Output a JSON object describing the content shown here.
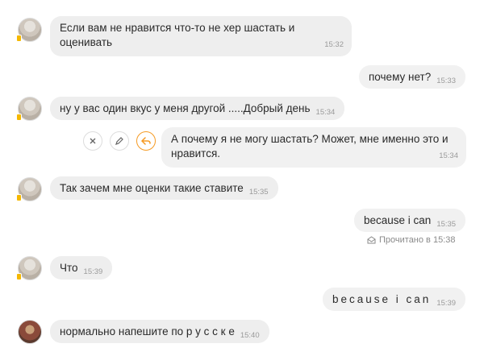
{
  "messages": [
    {
      "text_line1": "Если вам не нравится что-то не хер шастать и",
      "text_line2": "оценивать",
      "time": "15:32"
    },
    {
      "text": "почему нет?",
      "time": "15:33"
    },
    {
      "text": "ну у вас один вкус у меня другой .....Добрый день",
      "time": "15:34"
    },
    {
      "text_line1": "А почему я не могу шастать? Может, мне именно это и",
      "text_line2": "нравится.",
      "time": "15:34"
    },
    {
      "text": "Так зачем мне оценки такие ставите",
      "time": "15:35"
    },
    {
      "text": "because i can",
      "time": "15:35"
    },
    {
      "text": "Что",
      "time": "15:39"
    },
    {
      "text": "because i can",
      "time": "15:39"
    },
    {
      "text": "нормально напешите по р у с с к е",
      "time": "15:40"
    }
  ],
  "read_status": "Прочитано в 15:38",
  "actions": {
    "cancel_icon": "close-icon",
    "edit_icon": "pencil-icon",
    "reply_icon": "reply-icon"
  },
  "colors": {
    "bubble": "#eeeeee",
    "accent": "#f59a23",
    "online": "#f5b800"
  }
}
